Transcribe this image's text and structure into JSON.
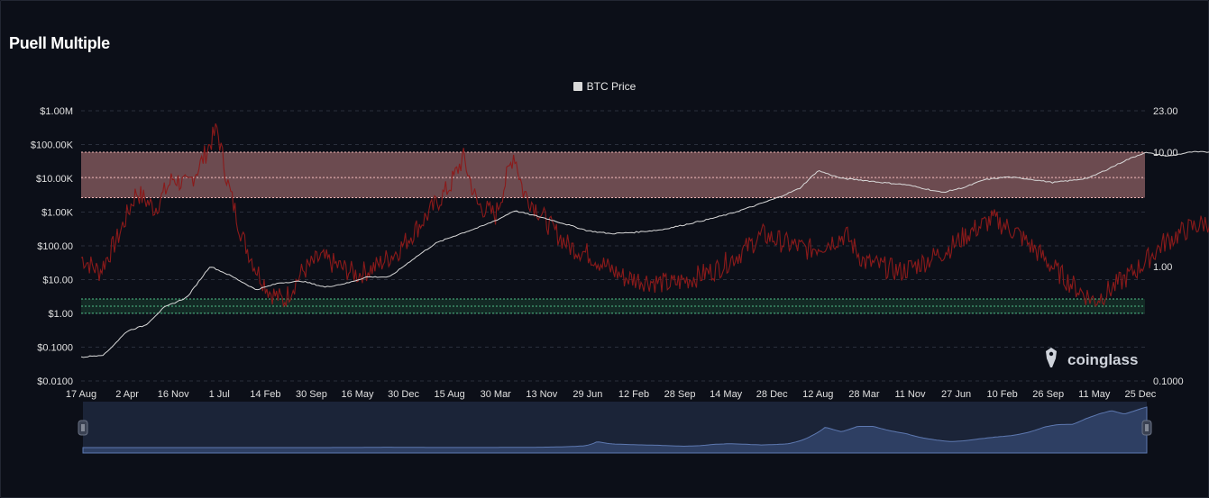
{
  "page": {
    "title": "Puell Multiple"
  },
  "legend": {
    "items": [
      {
        "label": "BTC Price",
        "color": "#d9d9d9"
      }
    ]
  },
  "watermark": {
    "text": "coinglass"
  },
  "colors": {
    "background": "#0c0f18",
    "puell_line": "#8b1a1a",
    "btc_line": "#d9d9d9",
    "high_zone": "#f4a0a0",
    "low_zone": "#2e8b57",
    "navigator_fill": "#2e3f63"
  },
  "chart_data": {
    "type": "line",
    "title": "Puell Multiple",
    "x_ticks": [
      "17 Aug",
      "2 Apr",
      "16 Nov",
      "1 Jul",
      "14 Feb",
      "30 Sep",
      "16 May",
      "30 Dec",
      "15 Aug",
      "30 Mar",
      "13 Nov",
      "29 Jun",
      "12 Feb",
      "28 Sep",
      "14 May",
      "28 Dec",
      "12 Aug",
      "28 Mar",
      "11 Nov",
      "27 Jun",
      "10 Feb",
      "26 Sep",
      "11 May",
      "25 Dec"
    ],
    "y_left": {
      "scale": "log",
      "ticks": [
        "$1.00M",
        "$100.00K",
        "$10.00K",
        "$1.00K",
        "$100.00",
        "$10.00",
        "$1.00",
        "$0.1000",
        "$0.0100"
      ],
      "min": 0.01,
      "max": 1000000
    },
    "y_right": {
      "scale": "log",
      "ticks": [
        "23.00",
        "10.00",
        "1.00",
        "0.1000"
      ],
      "min": 0.1,
      "max": 23
    },
    "zones": [
      {
        "name": "high",
        "axis": "right",
        "from": 4,
        "to": 10,
        "mid": 6
      },
      {
        "name": "low",
        "axis": "right",
        "from": 0.39,
        "to": 0.52,
        "mid": 0.45
      }
    ],
    "grid": true,
    "legend_position": "top-center",
    "series": [
      {
        "name": "BTC Price",
        "axis": "left",
        "points": [
          [
            0,
            0.05
          ],
          [
            0.5,
            0.06
          ],
          [
            1.0,
            0.3
          ],
          [
            1.4,
            0.45
          ],
          [
            1.8,
            1.5
          ],
          [
            2.3,
            3
          ],
          [
            2.8,
            25
          ],
          [
            3.3,
            12
          ],
          [
            3.8,
            5
          ],
          [
            4.3,
            8
          ],
          [
            4.8,
            9
          ],
          [
            5.3,
            6
          ],
          [
            5.8,
            8
          ],
          [
            6.2,
            12
          ],
          [
            6.7,
            12
          ],
          [
            7.2,
            40
          ],
          [
            7.7,
            120
          ],
          [
            8.2,
            220
          ],
          [
            8.7,
            380
          ],
          [
            9.1,
            650
          ],
          [
            9.4,
            1100
          ],
          [
            10.0,
            700
          ],
          [
            10.5,
            450
          ],
          [
            11.0,
            280
          ],
          [
            11.5,
            230
          ],
          [
            12.0,
            250
          ],
          [
            12.6,
            300
          ],
          [
            13.1,
            420
          ],
          [
            13.6,
            600
          ],
          [
            14.1,
            900
          ],
          [
            14.6,
            1500
          ],
          [
            15.1,
            2600
          ],
          [
            15.6,
            5000
          ],
          [
            16.0,
            17000
          ],
          [
            16.5,
            10000
          ],
          [
            16.9,
            9000
          ],
          [
            17.4,
            7500
          ],
          [
            17.9,
            6500
          ],
          [
            18.3,
            5000
          ],
          [
            18.7,
            3800
          ],
          [
            19.2,
            5500
          ],
          [
            19.6,
            9000
          ],
          [
            20.1,
            11000
          ],
          [
            20.6,
            9500
          ],
          [
            21.1,
            7500
          ],
          [
            21.6,
            9000
          ],
          [
            21.9,
            10500
          ],
          [
            22.3,
            19000
          ],
          [
            22.7,
            35000
          ],
          [
            23.1,
            58000
          ],
          [
            23.6,
            45000
          ],
          [
            24.1,
            60000
          ],
          [
            24.6,
            60000
          ],
          [
            25.1,
            48000
          ],
          [
            25.6,
            40000
          ],
          [
            26.1,
            28000
          ],
          [
            26.5,
            22000
          ],
          [
            27.0,
            16800
          ],
          [
            27.5,
            20000
          ],
          [
            27.9,
            25000
          ],
          [
            28.4,
            30000
          ],
          [
            28.9,
            34000
          ],
          [
            29.4,
            43000
          ],
          [
            29.9,
            58000
          ],
          [
            30.3,
            65000
          ],
          [
            30.8,
            66000
          ],
          [
            31.2,
            82000
          ],
          [
            31.6,
            95000
          ],
          [
            32.0,
            105000
          ],
          [
            32.4,
            95000
          ],
          [
            32.9,
            110000
          ],
          [
            33.1,
            115000
          ]
        ]
      },
      {
        "name": "Puell Multiple",
        "axis": "right",
        "points": [
          [
            0,
            1.2
          ],
          [
            0.4,
            0.9
          ],
          [
            0.8,
            1.8
          ],
          [
            1.2,
            4.5
          ],
          [
            1.6,
            3.2
          ],
          [
            2.0,
            6
          ],
          [
            2.3,
            5
          ],
          [
            2.6,
            8
          ],
          [
            2.95,
            16
          ],
          [
            3.2,
            5
          ],
          [
            3.5,
            1.8
          ],
          [
            3.8,
            0.95
          ],
          [
            4.1,
            0.6
          ],
          [
            4.4,
            0.5
          ],
          [
            4.8,
            0.9
          ],
          [
            5.2,
            1.2
          ],
          [
            5.6,
            1.0
          ],
          [
            6.0,
            0.85
          ],
          [
            6.4,
            1.0
          ],
          [
            6.9,
            1.4
          ],
          [
            7.3,
            2.2
          ],
          [
            7.7,
            3.5
          ],
          [
            8.0,
            5
          ],
          [
            8.3,
            9
          ],
          [
            8.6,
            3.5
          ],
          [
            9.0,
            2.8
          ],
          [
            9.4,
            10
          ],
          [
            9.6,
            4.5
          ],
          [
            9.9,
            3.2
          ],
          [
            10.2,
            2.2
          ],
          [
            10.6,
            1.5
          ],
          [
            11.0,
            1.3
          ],
          [
            11.4,
            1.0
          ],
          [
            11.8,
            0.8
          ],
          [
            12.3,
            0.75
          ],
          [
            12.8,
            0.7
          ],
          [
            13.3,
            0.8
          ],
          [
            13.8,
            0.95
          ],
          [
            14.3,
            1.3
          ],
          [
            14.8,
            1.9
          ],
          [
            15.3,
            1.6
          ],
          [
            15.8,
            1.4
          ],
          [
            16.2,
            1.6
          ],
          [
            16.6,
            1.9
          ],
          [
            17.0,
            1.1
          ],
          [
            17.4,
            1.0
          ],
          [
            17.8,
            0.9
          ],
          [
            18.3,
            1.1
          ],
          [
            18.8,
            1.4
          ],
          [
            19.3,
            2.0
          ],
          [
            19.8,
            2.6
          ],
          [
            20.3,
            2.0
          ],
          [
            20.8,
            1.3
          ],
          [
            21.2,
            0.9
          ],
          [
            21.6,
            0.65
          ],
          [
            22.0,
            0.5
          ],
          [
            22.5,
            0.7
          ],
          [
            23.0,
            1.0
          ],
          [
            23.5,
            1.6
          ],
          [
            24.0,
            2.1
          ],
          [
            24.5,
            2.5
          ],
          [
            25.0,
            2.0
          ],
          [
            25.5,
            1.5
          ],
          [
            26.0,
            1.4
          ],
          [
            26.5,
            1.5
          ],
          [
            27.0,
            1.2
          ],
          [
            27.5,
            1.1
          ],
          [
            28.0,
            1.5
          ],
          [
            28.5,
            1.3
          ],
          [
            29.0,
            0.95
          ],
          [
            29.5,
            0.8
          ],
          [
            30.0,
            0.65
          ],
          [
            30.5,
            0.7
          ],
          [
            31.0,
            0.85
          ],
          [
            31.5,
            1.1
          ],
          [
            32.0,
            1.3
          ],
          [
            32.5,
            1.5
          ],
          [
            33.0,
            1.6
          ],
          [
            33.1,
            1.2
          ]
        ]
      }
    ]
  }
}
